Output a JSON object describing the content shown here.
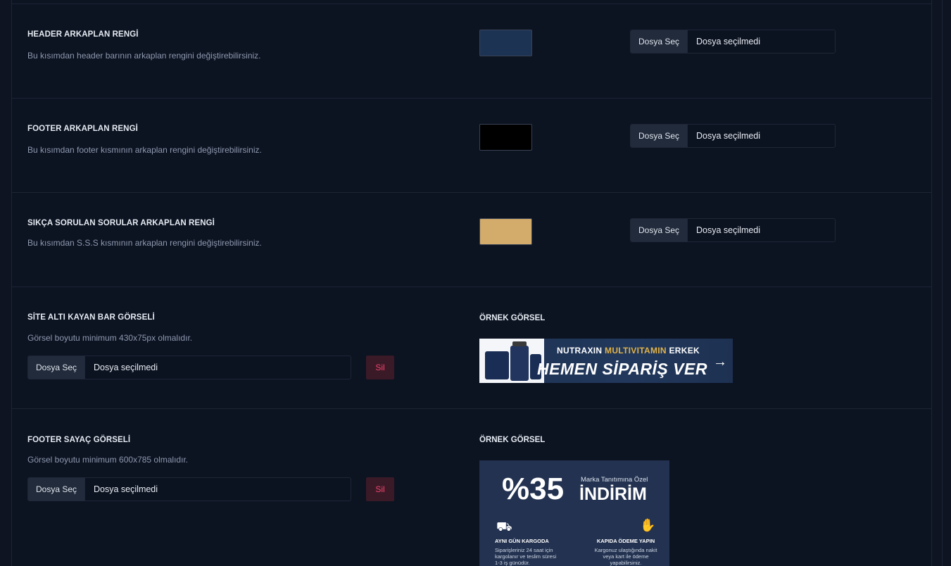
{
  "file_input": {
    "button_label": "Dosya Seç",
    "empty_text": "Dosya seçilmedi"
  },
  "delete_label": "Sil",
  "sample_label": "ÖRNEK GÖRSEL",
  "rows": [
    {
      "title": "HEADER ARKAPLAN RENGİ",
      "desc": "Bu kısımdan header barının arkaplan rengini değiştirebilirsiniz.",
      "color": "#1d3354"
    },
    {
      "title": "FOOTER ARKAPLAN RENGİ",
      "desc": "Bu kısımdan footer kısmının arkaplan rengini değiştirebilirsiniz.",
      "color": "#000000"
    },
    {
      "title": "SIKÇA SORULAN SORULAR ARKAPLAN RENGİ",
      "desc": "Bu kısımdan S.S.S kısmının arkaplan rengini değiştirebilirsiniz.",
      "color": "#d3ab6b"
    },
    {
      "title": "SİTE ALTI KAYAN BAR GÖRSELİ",
      "desc": "Görsel boyutu minimum 430x75px olmalıdır."
    },
    {
      "title": "FOOTER SAYAÇ GÖRSELİ",
      "desc": "Görsel boyutu minimum 600x785 olmalıdır."
    }
  ],
  "banner": {
    "brand": "NUTRAXIN",
    "highlight": "MULTIVITAMIN",
    "suffix": "ERKEK",
    "headline": "HEMEN SİPARİŞ VER",
    "arrow_icon": "arrow-right-icon"
  },
  "poster": {
    "discount": "%35",
    "subtitle": "Marka Tanıtımına Özel",
    "headline": "İNDİRİM",
    "left_title": "AYNI GÜN KARGODA",
    "left_text": "Siparişleriniz 24 saat için kargolanır ve teslim süresi 1-3 iş günüdür.",
    "right_title": "KAPIDA ÖDEME YAPIN",
    "right_text": "Kargonuz ulaştığında nakit veya kart ile ödeme yapabilirsiniz.",
    "left_icon": "delivery-truck-icon",
    "right_icon": "payment-hand-icon"
  }
}
